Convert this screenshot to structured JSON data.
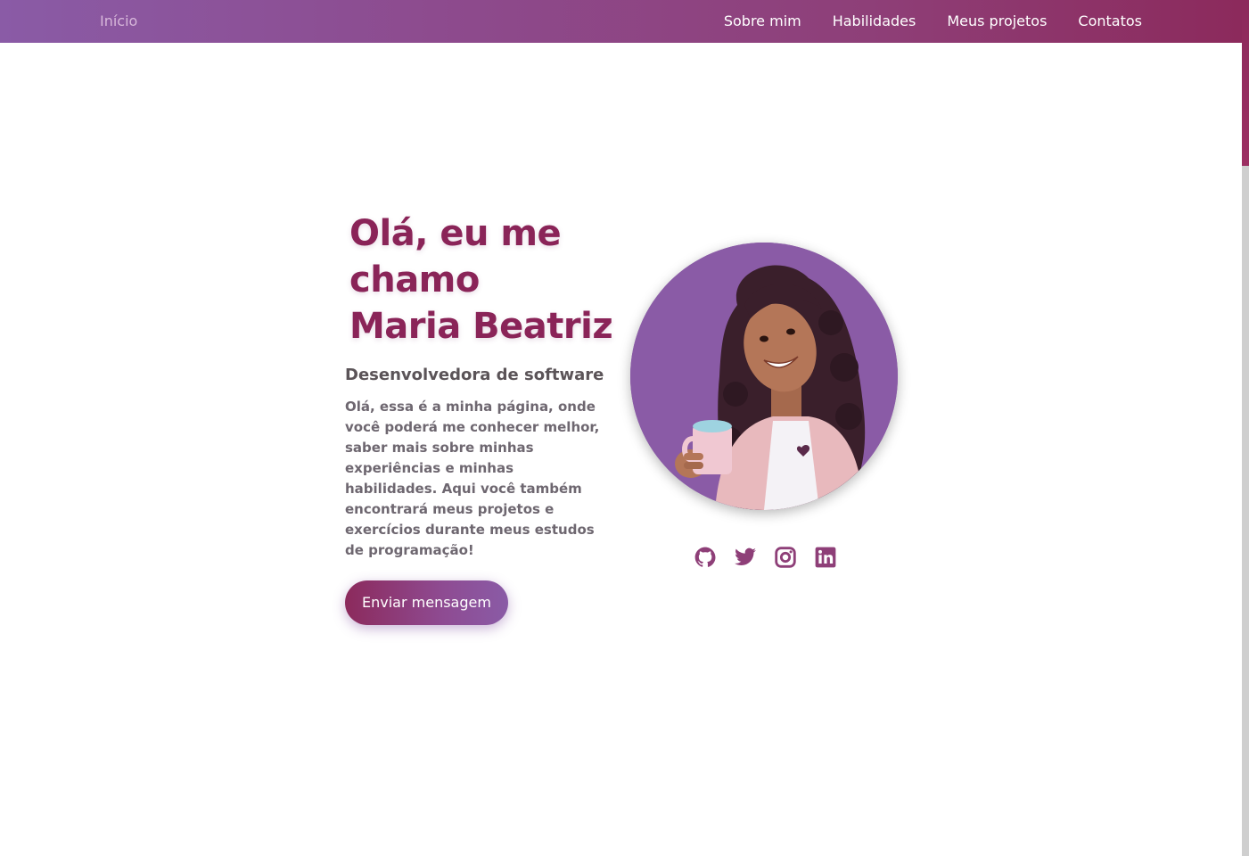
{
  "navbar": {
    "home_label": "Início",
    "links": [
      "Sobre mim",
      "Habilidades",
      "Meus projetos",
      "Contatos"
    ]
  },
  "hero": {
    "title_lines": [
      "Olá, eu me",
      "chamo",
      "Maria Beatriz"
    ],
    "subtitle": "Desenvolvedora de software",
    "description": "Olá, essa é a minha página, onde você poderá me conhecer melhor, saber mais sobre minhas experiências e minhas habilidades. Aqui você também encontrará meus projetos e exercícios durante meus estudos de programação!",
    "cta_label": "Enviar mensagem"
  },
  "avatar": {
    "background_color": "#8a5ba6"
  },
  "socials": [
    {
      "icon": "github-icon"
    },
    {
      "icon": "twitter-icon"
    },
    {
      "icon": "instagram-icon"
    },
    {
      "icon": "linkedin-icon"
    }
  ],
  "colors": {
    "brand_purple": "#8a5ba6",
    "brand_wine": "#8c2a5c",
    "icon_color": "#8e3f78"
  }
}
